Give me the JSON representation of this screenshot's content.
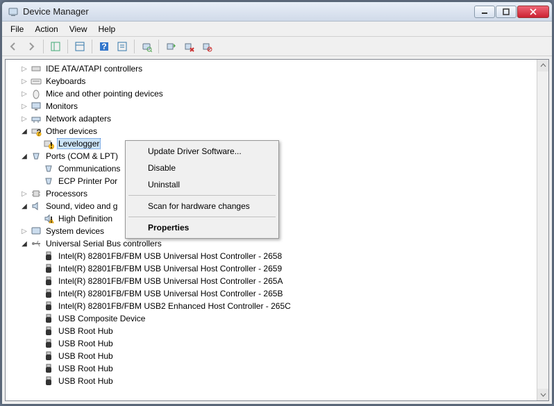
{
  "window": {
    "title": "Device Manager"
  },
  "menu": {
    "file": "File",
    "action": "Action",
    "view": "View",
    "help": "Help"
  },
  "tree": {
    "ide": {
      "label": "IDE ATA/ATAPI controllers"
    },
    "keyboards": {
      "label": "Keyboards"
    },
    "mice": {
      "label": "Mice and other pointing devices"
    },
    "monitors": {
      "label": "Monitors"
    },
    "network": {
      "label": "Network adapters"
    },
    "other": {
      "label": "Other devices"
    },
    "levelogger": {
      "label": "Levelogger"
    },
    "ports": {
      "label": "Ports (COM & LPT)"
    },
    "commport": {
      "label": "Communications"
    },
    "ecpport": {
      "label": "ECP Printer Por"
    },
    "processors": {
      "label": "Processors"
    },
    "sound": {
      "label": "Sound, video and g"
    },
    "hdaudio": {
      "label": "High Definition"
    },
    "sysdev": {
      "label": "System devices"
    },
    "usb": {
      "label": "Universal Serial Bus controllers"
    },
    "usb0": {
      "label": "Intel(R) 82801FB/FBM USB Universal Host Controller - 2658"
    },
    "usb1": {
      "label": "Intel(R) 82801FB/FBM USB Universal Host Controller - 2659"
    },
    "usb2": {
      "label": "Intel(R) 82801FB/FBM USB Universal Host Controller - 265A"
    },
    "usb3": {
      "label": "Intel(R) 82801FB/FBM USB Universal Host Controller - 265B"
    },
    "usb4": {
      "label": "Intel(R) 82801FB/FBM USB2 Enhanced Host Controller - 265C"
    },
    "usb5": {
      "label": "USB Composite Device"
    },
    "usb6": {
      "label": "USB Root Hub"
    },
    "usb7": {
      "label": "USB Root Hub"
    },
    "usb8": {
      "label": "USB Root Hub"
    },
    "usb9": {
      "label": "USB Root Hub"
    },
    "usb10": {
      "label": "USB Root Hub"
    }
  },
  "context_menu": {
    "update": "Update Driver Software...",
    "disable": "Disable",
    "uninstall": "Uninstall",
    "scan": "Scan for hardware changes",
    "properties": "Properties"
  }
}
